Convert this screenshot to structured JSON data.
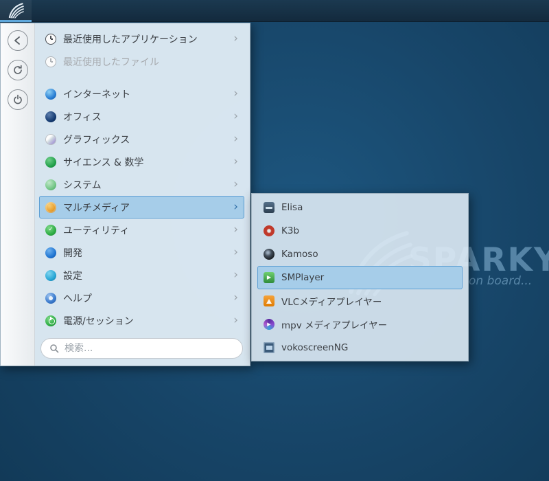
{
  "panel": {
    "launcher_icon": "sparky-menu-logo"
  },
  "watermark": {
    "title": "SPARKY",
    "subtitle": "on board..."
  },
  "menu": {
    "strip_buttons": [
      {
        "id": "back",
        "icon": "back-arrow"
      },
      {
        "id": "switch-user",
        "icon": "switch-user"
      },
      {
        "id": "power",
        "icon": "power"
      }
    ],
    "items": [
      {
        "id": "recent-apps",
        "label": "最近使用したアプリケーション",
        "icon": "clock",
        "has_submenu": true
      },
      {
        "id": "recent-files",
        "label": "最近使用したファイル",
        "icon": "clock",
        "disabled": true
      },
      {
        "id": "internet",
        "label": "インターネット",
        "icon": "internet-globe",
        "has_submenu": true,
        "group_start": true
      },
      {
        "id": "office",
        "label": "オフィス",
        "icon": "office",
        "has_submenu": true
      },
      {
        "id": "graphics",
        "label": "グラフィックス",
        "icon": "graphics",
        "has_submenu": true
      },
      {
        "id": "science",
        "label": "サイエンス & 数学",
        "icon": "science",
        "has_submenu": true
      },
      {
        "id": "system",
        "label": "システム",
        "icon": "system",
        "has_submenu": true
      },
      {
        "id": "multimedia",
        "label": "マルチメディア",
        "icon": "multimedia",
        "has_submenu": true,
        "selected": true
      },
      {
        "id": "utilities",
        "label": "ユーティリティ",
        "icon": "utilities",
        "has_submenu": true
      },
      {
        "id": "development",
        "label": "開発",
        "icon": "development",
        "has_submenu": true
      },
      {
        "id": "settings",
        "label": "設定",
        "icon": "settings",
        "has_submenu": true
      },
      {
        "id": "help",
        "label": "ヘルプ",
        "icon": "help",
        "has_submenu": true
      },
      {
        "id": "power-session",
        "label": "電源/セッション",
        "icon": "power-session",
        "has_submenu": true
      }
    ],
    "search": {
      "placeholder": "検索..."
    }
  },
  "submenu": {
    "items": [
      {
        "id": "elisa",
        "label": "Elisa",
        "icon": "elisa"
      },
      {
        "id": "k3b",
        "label": "K3b",
        "icon": "k3b"
      },
      {
        "id": "kamoso",
        "label": "Kamoso",
        "icon": "kamoso"
      },
      {
        "id": "smplayer",
        "label": "SMPlayer",
        "icon": "smplayer",
        "selected": true
      },
      {
        "id": "vlc",
        "label": "VLCメディアプレイヤー",
        "icon": "vlc"
      },
      {
        "id": "mpv",
        "label": "mpv メディアプレイヤー",
        "icon": "mpv"
      },
      {
        "id": "vokoscreenng",
        "label": "vokoscreenNG",
        "icon": "vokoscreenng"
      }
    ]
  }
}
